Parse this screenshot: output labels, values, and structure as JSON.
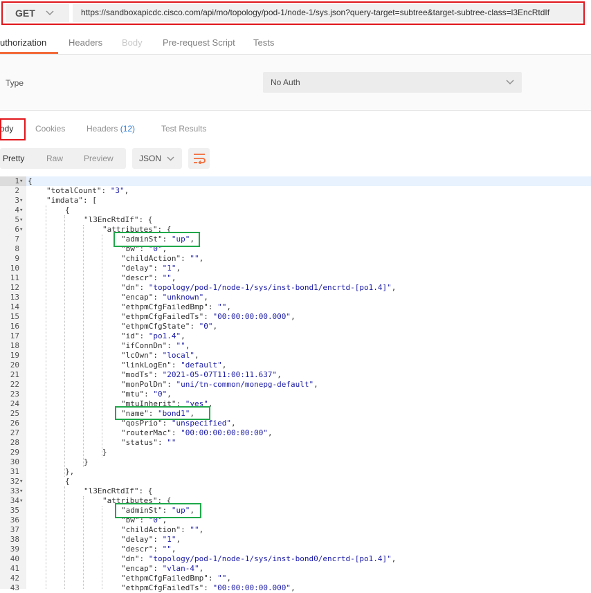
{
  "request": {
    "method": "GET",
    "url": "https://sandboxapicdc.cisco.com/api/mo/topology/pod-1/node-1/sys.json?query-target=subtree&target-subtree-class=l3EncRtdIf"
  },
  "request_tabs": [
    "uthorization",
    "Headers",
    "Body",
    "Pre-request Script",
    "Tests"
  ],
  "auth": {
    "type_label": "Type",
    "selected": "No Auth"
  },
  "response_tabs": {
    "body": "ody",
    "cookies": "Cookies",
    "headers": "Headers",
    "headers_count": "(12)",
    "test_results": "Test Results"
  },
  "view_modes": [
    "Pretty",
    "Raw",
    "Preview"
  ],
  "format": "JSON",
  "icons": {
    "method_dropdown": "chevron-down-icon",
    "auth_dropdown": "chevron-down-icon",
    "format_dropdown": "chevron-down-icon",
    "wrap": "wrap-lines-icon"
  },
  "colors": {
    "accent": "#f26b3a",
    "string": "#1a1aa6",
    "callout_red": "#e0161b",
    "callout_green": "#1fa84a",
    "count": "#2a7bd6"
  },
  "code_lines": [
    {
      "n": "1",
      "fold": "▾",
      "indent": 0,
      "text": "{"
    },
    {
      "n": "2",
      "indent": 1,
      "key": "\"totalCount\"",
      "val": "\"3\"",
      "tail": ","
    },
    {
      "n": "3",
      "fold": "▾",
      "indent": 1,
      "key": "\"imdata\"",
      "tail": ": ["
    },
    {
      "n": "4",
      "fold": "▾",
      "indent": 2,
      "text": "{"
    },
    {
      "n": "5",
      "fold": "▾",
      "indent": 3,
      "key": "\"l3EncRtdIf\"",
      "tail": ": {"
    },
    {
      "n": "6",
      "fold": "▾",
      "indent": 4,
      "key": "\"attributes\"",
      "tail": ": {"
    },
    {
      "n": "7",
      "indent": 5,
      "key": "\"adminSt\"",
      "val": "\"up\"",
      "tail": ","
    },
    {
      "n": "8",
      "indent": 5,
      "key": "\"bw\"",
      "val": "\"0\"",
      "tail": ","
    },
    {
      "n": "9",
      "indent": 5,
      "key": "\"childAction\"",
      "val": "\"\"",
      "tail": ","
    },
    {
      "n": "10",
      "indent": 5,
      "key": "\"delay\"",
      "val": "\"1\"",
      "tail": ","
    },
    {
      "n": "11",
      "indent": 5,
      "key": "\"descr\"",
      "val": "\"\"",
      "tail": ","
    },
    {
      "n": "12",
      "indent": 5,
      "key": "\"dn\"",
      "val": "\"topology/pod-1/node-1/sys/inst-bond1/encrtd-[po1.4]\"",
      "tail": ","
    },
    {
      "n": "13",
      "indent": 5,
      "key": "\"encap\"",
      "val": "\"unknown\"",
      "tail": ","
    },
    {
      "n": "14",
      "indent": 5,
      "key": "\"ethpmCfgFailedBmp\"",
      "val": "\"\"",
      "tail": ","
    },
    {
      "n": "15",
      "indent": 5,
      "key": "\"ethpmCfgFailedTs\"",
      "val": "\"00:00:00:00.000\"",
      "tail": ","
    },
    {
      "n": "16",
      "indent": 5,
      "key": "\"ethpmCfgState\"",
      "val": "\"0\"",
      "tail": ","
    },
    {
      "n": "17",
      "indent": 5,
      "key": "\"id\"",
      "val": "\"po1.4\"",
      "tail": ","
    },
    {
      "n": "18",
      "indent": 5,
      "key": "\"ifConnDn\"",
      "val": "\"\"",
      "tail": ","
    },
    {
      "n": "19",
      "indent": 5,
      "key": "\"lcOwn\"",
      "val": "\"local\"",
      "tail": ","
    },
    {
      "n": "20",
      "indent": 5,
      "key": "\"linkLogEn\"",
      "val": "\"default\"",
      "tail": ","
    },
    {
      "n": "21",
      "indent": 5,
      "key": "\"modTs\"",
      "val": "\"2021-05-07T11:00:11.637\"",
      "tail": ","
    },
    {
      "n": "22",
      "indent": 5,
      "key": "\"monPolDn\"",
      "val": "\"uni/tn-common/monepg-default\"",
      "tail": ","
    },
    {
      "n": "23",
      "indent": 5,
      "key": "\"mtu\"",
      "val": "\"0\"",
      "tail": ","
    },
    {
      "n": "24",
      "indent": 5,
      "key": "\"mtuInherit\"",
      "val": "\"yes\"",
      "tail": ","
    },
    {
      "n": "25",
      "indent": 5,
      "key": "\"name\"",
      "val": "\"bond1\"",
      "tail": ","
    },
    {
      "n": "26",
      "indent": 5,
      "key": "\"qosPrio\"",
      "val": "\"unspecified\"",
      "tail": ","
    },
    {
      "n": "27",
      "indent": 5,
      "key": "\"routerMac\"",
      "val": "\"00:00:00:00:00:00\"",
      "tail": ","
    },
    {
      "n": "28",
      "indent": 5,
      "key": "\"status\"",
      "val": "\"\"",
      "tail": ""
    },
    {
      "n": "29",
      "indent": 4,
      "text": "}"
    },
    {
      "n": "30",
      "indent": 3,
      "text": "}"
    },
    {
      "n": "31",
      "indent": 2,
      "text": "},"
    },
    {
      "n": "32",
      "fold": "▾",
      "indent": 2,
      "text": "{"
    },
    {
      "n": "33",
      "fold": "▾",
      "indent": 3,
      "key": "\"l3EncRtdIf\"",
      "tail": ": {"
    },
    {
      "n": "34",
      "fold": "▾",
      "indent": 4,
      "key": "\"attributes\"",
      "tail": ": {"
    },
    {
      "n": "35",
      "indent": 5,
      "key": "\"adminSt\"",
      "val": "\"up\"",
      "tail": ","
    },
    {
      "n": "36",
      "indent": 5,
      "key": "\"bw\"",
      "val": "\"0\"",
      "tail": ","
    },
    {
      "n": "37",
      "indent": 5,
      "key": "\"childAction\"",
      "val": "\"\"",
      "tail": ","
    },
    {
      "n": "38",
      "indent": 5,
      "key": "\"delay\"",
      "val": "\"1\"",
      "tail": ","
    },
    {
      "n": "39",
      "indent": 5,
      "key": "\"descr\"",
      "val": "\"\"",
      "tail": ","
    },
    {
      "n": "40",
      "indent": 5,
      "key": "\"dn\"",
      "val": "\"topology/pod-1/node-1/sys/inst-bond0/encrtd-[po1.4]\"",
      "tail": ","
    },
    {
      "n": "41",
      "indent": 5,
      "key": "\"encap\"",
      "val": "\"vlan-4\"",
      "tail": ","
    },
    {
      "n": "42",
      "indent": 5,
      "key": "\"ethpmCfgFailedBmp\"",
      "val": "\"\"",
      "tail": ","
    },
    {
      "n": "43",
      "indent": 5,
      "key": "\"ethpmCfgFailedTs\"",
      "val": "\"00:00:00:00.000\"",
      "tail": ","
    }
  ]
}
